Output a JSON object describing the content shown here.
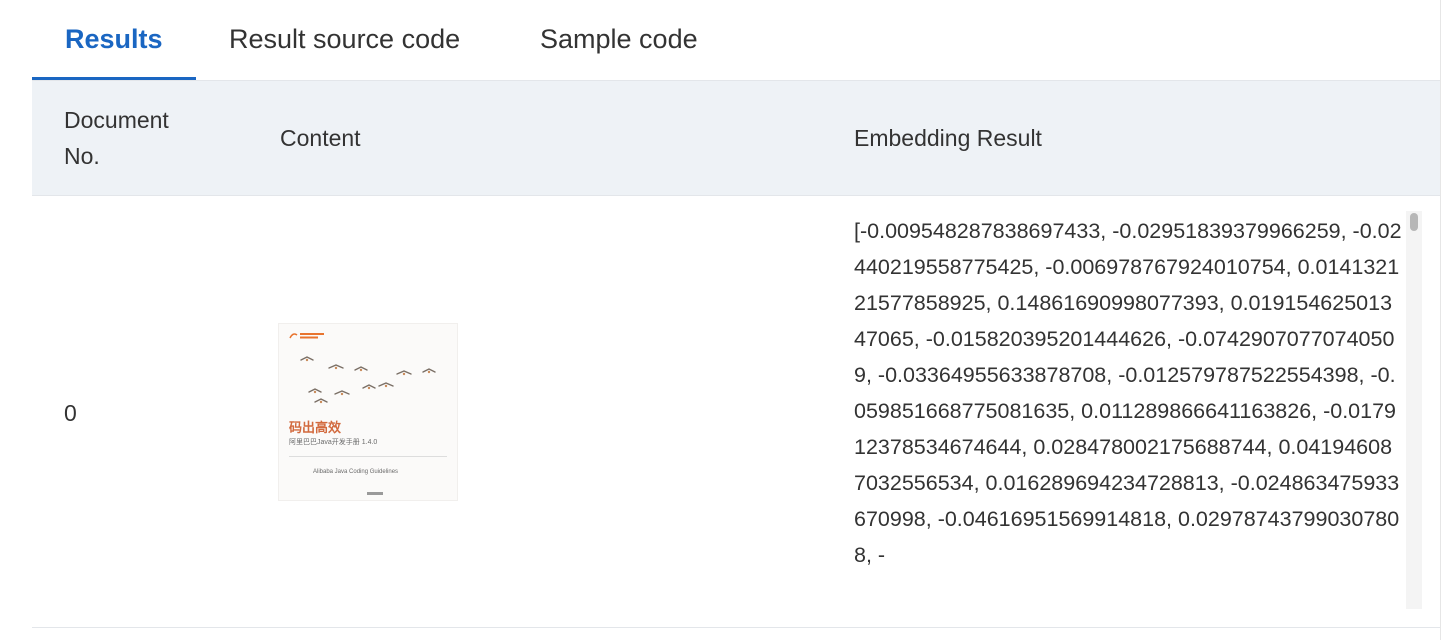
{
  "tabs": [
    {
      "label": "Results",
      "active": true
    },
    {
      "label": "Result source code",
      "active": false
    },
    {
      "label": "Sample code",
      "active": false
    }
  ],
  "table": {
    "headers": {
      "doc_no_line1": "Document",
      "doc_no_line2": "No.",
      "content": "Content",
      "embedding": "Embedding Result"
    },
    "rows": [
      {
        "doc_no": "0",
        "thumbnail": {
          "title": "码出高效",
          "subtitle": "阿里巴巴Java开发手册  1.4.0",
          "english": "Alibaba Java Coding Guidelines"
        },
        "embedding": "[-0.009548287838697433, -0.02951839379966259, -0.02440219558775425, -0.006978767924010754, 0.014132121577858925, 0.14861690998077393, 0.01915462501347065, -0.015820395201444626, -0.07429070770740509, -0.03364955633878708, -0.012579787522554398, -0.05985166877508163​5, 0.011289866641163826, -0.017912378534674644, 0.028478002175688744, 0.041946087032556534, 0.016289694234728813, -0.024863475933670998, -0.04616951569914818, 0.029787437990307808, -"
      }
    ]
  },
  "colors": {
    "accent": "#1a66c2",
    "header_bg": "#eef2f6",
    "cover_title": "#d26a3e"
  }
}
